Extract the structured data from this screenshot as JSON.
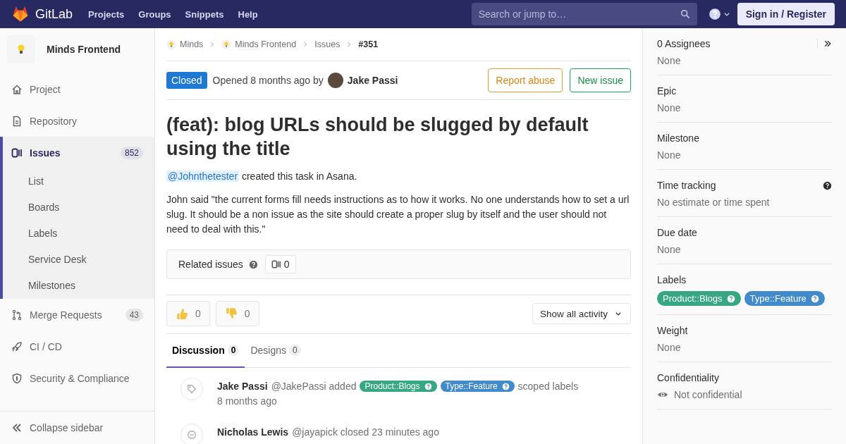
{
  "header": {
    "brand": "GitLab",
    "nav": [
      "Projects",
      "Groups",
      "Snippets",
      "Help"
    ],
    "search": {
      "placeholder": "Search or jump to…"
    },
    "signin": "Sign in / Register"
  },
  "sidebar": {
    "project": "Minds Frontend",
    "items": [
      {
        "label": "Project",
        "kind": "home",
        "selected": false
      },
      {
        "label": "Repository",
        "kind": "doc",
        "selected": false
      },
      {
        "label": "Issues",
        "kind": "issues",
        "selected": true,
        "count": "852",
        "children": [
          {
            "label": "List",
            "selected": false
          },
          {
            "label": "Boards",
            "selected": false
          },
          {
            "label": "Labels",
            "selected": false
          },
          {
            "label": "Service Desk",
            "selected": false
          },
          {
            "label": "Milestones",
            "selected": false
          }
        ]
      },
      {
        "label": "Merge Requests",
        "kind": "merge",
        "selected": false,
        "count": "43"
      },
      {
        "label": "CI / CD",
        "kind": "rocket",
        "selected": false
      },
      {
        "label": "Security & Compliance",
        "kind": "shield",
        "selected": false
      }
    ],
    "collapse": "Collapse sidebar"
  },
  "breadcrumbs": [
    {
      "label": "Minds",
      "avatar": true
    },
    {
      "label": "Minds Frontend",
      "avatar": true
    },
    {
      "label": "Issues",
      "avatar": false
    },
    {
      "label": "#351",
      "avatar": false
    }
  ],
  "issue": {
    "status": "Closed",
    "opened": "Opened 8 months ago by",
    "author": "Jake Passi",
    "actions": [
      {
        "label": "Report abuse",
        "kind": "warning"
      },
      {
        "label": "New issue",
        "kind": "success"
      }
    ],
    "title": "(feat): blog URLs should be slugged by default using the title",
    "mention": "@Johnthetester",
    "mention_rest": "created this task in Asana.",
    "body": "John said \"the current forms fill needs instructions as to how it works. No one understands how to set a url slug. It should be a non issue as the site should create a proper slug by itself and the user should not need to deal with this.\"",
    "related": {
      "label": "Related issues",
      "count": "0"
    },
    "awards": [
      {
        "kind": "up",
        "count": "0"
      },
      {
        "kind": "down",
        "count": "0"
      }
    ],
    "filter": "Show all activity",
    "tabs": [
      {
        "label": "Discussion",
        "count": "0",
        "selected": true
      },
      {
        "label": "Designs",
        "count": "0",
        "selected": false
      }
    ],
    "notes": [
      {
        "kind": "label",
        "author": "Jake Passi",
        "handle": "@JakePassi",
        "action": "added",
        "labels": [
          {
            "name": "Product::Blogs",
            "color": "#36a782"
          },
          {
            "name": "Type::Feature",
            "color": "#428bca"
          }
        ],
        "after": "scoped labels",
        "time": "8 months ago"
      },
      {
        "kind": "close",
        "author": "Nicholas Lewis",
        "handle": "@jayapick",
        "action": "closed 23 minutes ago"
      }
    ]
  },
  "right_sidebar": {
    "blocks": [
      {
        "title": "0 Assignees",
        "value": "None",
        "kind": "assignees"
      },
      {
        "title": "Epic",
        "value": "None",
        "kind": "text"
      },
      {
        "title": "Milestone",
        "value": "None",
        "kind": "text"
      },
      {
        "title": "Time tracking",
        "value": "No estimate or time spent",
        "kind": "help"
      },
      {
        "title": "Due date",
        "value": "None",
        "kind": "text"
      },
      {
        "title": "Labels",
        "kind": "labels",
        "labels": [
          {
            "name": "Product::Blogs",
            "color": "#36a782"
          },
          {
            "name": "Type::Feature",
            "color": "#428bca"
          }
        ]
      },
      {
        "title": "Weight",
        "value": "None",
        "kind": "text"
      },
      {
        "title": "Confidentiality",
        "value": "Not confidential",
        "kind": "eye"
      }
    ]
  }
}
